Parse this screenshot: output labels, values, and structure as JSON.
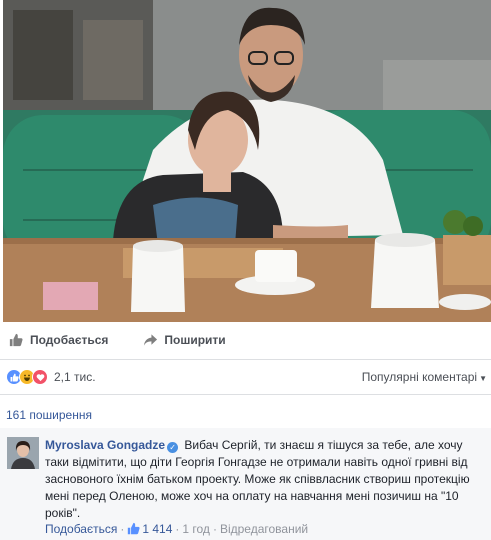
{
  "photo": {
    "alt": "Фото"
  },
  "actions": {
    "like_label": "Подобається",
    "share_label": "Поширити"
  },
  "reactions": {
    "icons": [
      "like-icon",
      "haha-icon",
      "love-icon"
    ],
    "count": "2,1 тис.",
    "sort_label": "Популярні коментарі"
  },
  "shares": {
    "label": "161 поширення"
  },
  "comment": {
    "author": "Myroslava Gongadze",
    "text": "Вибач Сергій, ти знаєш я тішуся за тебе, але хочу таки відмітити, що діти Георгія Гонгадзе не отримали навіть одної гривні від засновоного їхнім батьком проекту. Може як співвласник створиш протекцію мені перед Оленою, може хоч на оплату на навчання мені позичиш на \"10 років\".",
    "like_link": "Подобається",
    "likes": "1 414",
    "time": "1 год",
    "edited": "Відредагований"
  },
  "colors": {
    "link": "#365899",
    "like_blue": "#5890ff",
    "love_red": "#f25268",
    "haha_yellow": "#f7b928",
    "meta_gray": "#90949c"
  }
}
